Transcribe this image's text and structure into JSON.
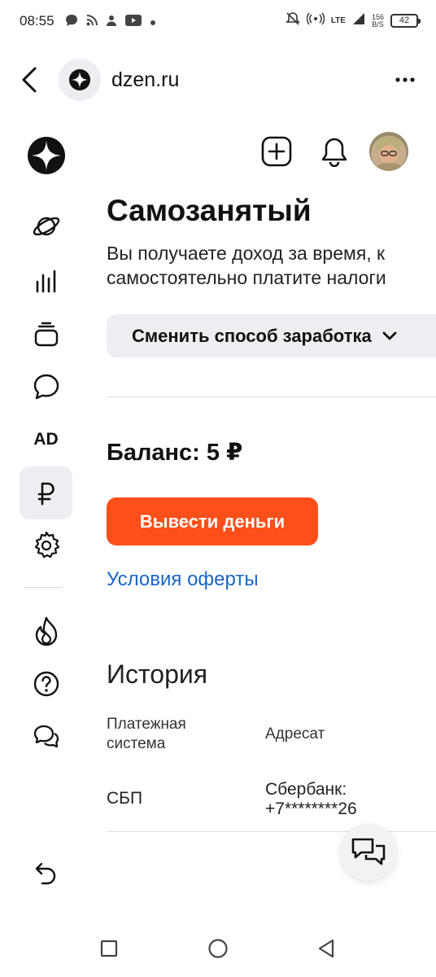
{
  "status_bar": {
    "time": "08:55",
    "network": "LTE",
    "speed_value": "156",
    "speed_unit": "B/S",
    "battery": "42"
  },
  "browser": {
    "url": "dzen.ru"
  },
  "sidebar": {
    "items": [
      {
        "icon": "dzen-logo-icon"
      },
      {
        "icon": "planet-icon"
      },
      {
        "icon": "stats-icon"
      },
      {
        "icon": "stack-icon"
      },
      {
        "icon": "comment-icon"
      },
      {
        "label": "AD"
      },
      {
        "icon": "ruble-icon",
        "active": true
      },
      {
        "icon": "gear-icon"
      },
      {
        "icon": "fire-icon"
      },
      {
        "icon": "help-icon"
      },
      {
        "icon": "chat-icon"
      },
      {
        "icon": "undo-icon"
      }
    ]
  },
  "main": {
    "title": "Самозанятый",
    "description_line1": "Вы получаете доход за время, к",
    "description_line2": "самостоятельно платите налоги",
    "mode_button": "Сменить способ заработка",
    "balance": "Баланс: 5 ₽",
    "withdraw_button": "Вывести деньги",
    "offer_link": "Условия оферты",
    "history_title": "История",
    "history": {
      "headers": [
        "Платежная система",
        "Адресат"
      ],
      "rows": [
        {
          "system": "СБП",
          "recipient_line1": "Сбербанк:",
          "recipient_line2": "+7********26"
        }
      ]
    }
  },
  "colors": {
    "accent": "#fc4f19",
    "link": "#1a67c4",
    "chip_bg": "#eceef1"
  }
}
